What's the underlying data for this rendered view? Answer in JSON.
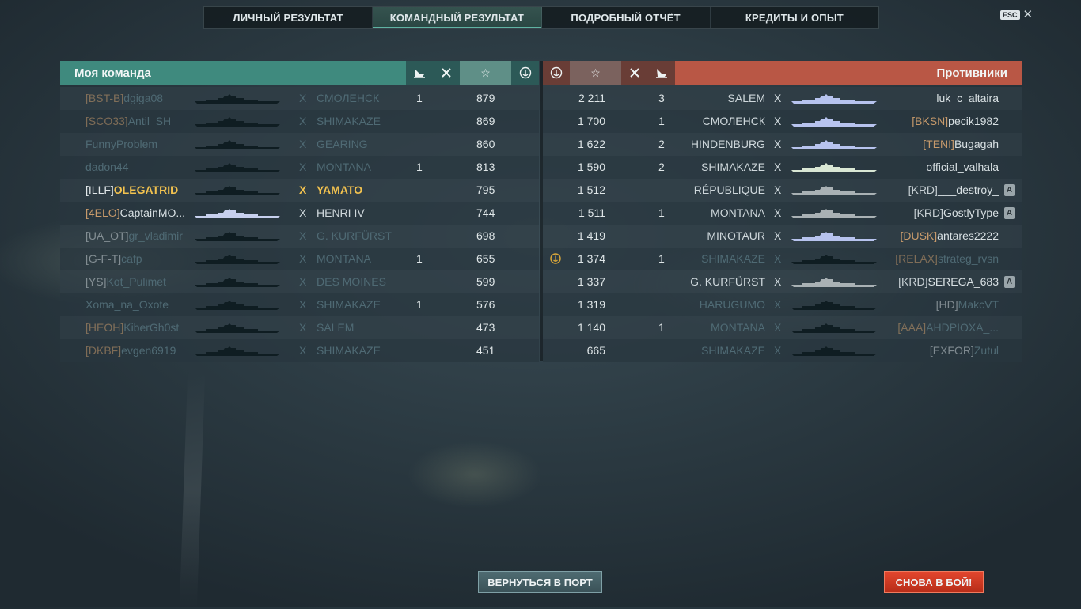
{
  "tabs": [
    {
      "label": "ЛИЧНЫЙ РЕЗУЛЬТАТ",
      "active": false
    },
    {
      "label": "КОМАНДНЫЙ РЕЗУЛЬТАТ",
      "active": true
    },
    {
      "label": "ПОДРОБНЫЙ ОТЧЁТ",
      "active": false
    },
    {
      "label": "КРЕДИТЫ И ОПЫТ",
      "active": false
    }
  ],
  "close": {
    "esc_label": "ESC",
    "icon": "close-icon"
  },
  "my_team": {
    "title": "Моя команда",
    "header_icons": [
      "ship-sunk-icon",
      "plane-kill-icon",
      "star-icon",
      "anchor-medal-icon"
    ],
    "players": [
      {
        "clan": "[BST-B]",
        "name": "dgiga08",
        "ship": "СМОЛЕНСК",
        "x": "X",
        "kills": "1",
        "score": "879",
        "dim": true,
        "highlight": false,
        "sil_color": "#0f1d22"
      },
      {
        "clan": "[SCO33]",
        "name": "Antil_SH",
        "ship": "SHIMAKAZE",
        "x": "X",
        "kills": "",
        "score": "869",
        "dim": true,
        "highlight": false,
        "sil_color": "#0f1d22"
      },
      {
        "clan": "",
        "name": "FunnyProblem",
        "ship": "GEARING",
        "x": "X",
        "kills": "",
        "score": "860",
        "dim": true,
        "highlight": false,
        "sil_color": "#0f1d22"
      },
      {
        "clan": "",
        "name": "dadon44",
        "ship": "MONTANA",
        "x": "X",
        "kills": "1",
        "score": "813",
        "dim": true,
        "highlight": false,
        "sil_color": "#0f1d22"
      },
      {
        "clan": "[ILLF]",
        "name": "OLEGATRID",
        "ship": "YAMATO",
        "x": "X",
        "kills": "",
        "score": "795",
        "dim": false,
        "highlight": true,
        "sil_color": "#0f1d22"
      },
      {
        "clan": "[4ELO]",
        "name": "CaptainMO...",
        "ship": "HENRI IV",
        "x": "X",
        "kills": "",
        "score": "744",
        "dim": false,
        "highlight": false,
        "sil_color": "#c7d0ee"
      },
      {
        "clan": "[UA_OT]",
        "name": "gr_vladimir",
        "ship": "G. KURFÜRST",
        "x": "X",
        "kills": "",
        "score": "698",
        "dim": true,
        "highlight": false,
        "clan_gray": true,
        "sil_color": "#0f1d22"
      },
      {
        "clan": "[G-F-T]",
        "name": "cafp",
        "ship": "MONTANA",
        "x": "X",
        "kills": "1",
        "score": "655",
        "dim": true,
        "highlight": false,
        "clan_gray": true,
        "sil_color": "#0f1d22"
      },
      {
        "clan": "[YS]",
        "name": "Kot_Pulimet",
        "ship": "DES MOINES",
        "x": "X",
        "kills": "",
        "score": "599",
        "dim": true,
        "highlight": false,
        "clan_gray": true,
        "sil_color": "#0f1d22"
      },
      {
        "clan": "",
        "name": "Xoma_na_Oxote",
        "ship": "SHIMAKAZE",
        "x": "X",
        "kills": "1",
        "score": "576",
        "dim": true,
        "highlight": false,
        "sil_color": "#0f1d22"
      },
      {
        "clan": "[HEOH]",
        "name": "KiberGh0st",
        "ship": "SALEM",
        "x": "X",
        "kills": "",
        "score": "473",
        "dim": true,
        "highlight": false,
        "sil_color": "#0f1d22"
      },
      {
        "clan": "[DKBF]",
        "name": "evgen6919",
        "ship": "SHIMAKAZE",
        "x": "X",
        "kills": "",
        "score": "451",
        "dim": true,
        "highlight": false,
        "sil_color": "#0f1d22"
      }
    ]
  },
  "enemy_team": {
    "title": "Противники",
    "header_icons": [
      "anchor-medal-icon",
      "star-icon",
      "plane-kill-icon",
      "ship-sunk-icon"
    ],
    "players": [
      {
        "score": "2 211",
        "kills": "3",
        "ship": "SALEM",
        "x": "X",
        "clan": "",
        "name": "luk_c_altaira",
        "dim": false,
        "badge": false,
        "division": "",
        "sil_color": "#b7c3ee"
      },
      {
        "score": "1 700",
        "kills": "1",
        "ship": "СМОЛЕНСК",
        "x": "X",
        "clan": "[BKSN]",
        "name": "pecik1982",
        "dim": false,
        "badge": false,
        "division": "",
        "sil_color": "#b7c3ee"
      },
      {
        "score": "1 622",
        "kills": "2",
        "ship": "HINDENBURG",
        "x": "X",
        "clan": "[TENI]",
        "name": "Bugagah",
        "dim": false,
        "badge": false,
        "division": "",
        "sil_color": "#b7c3ee"
      },
      {
        "score": "1 590",
        "kills": "2",
        "ship": "SHIMAKAZE",
        "x": "X",
        "clan": "",
        "name": "official_valhala",
        "dim": false,
        "badge": false,
        "division": "",
        "sil_color": "#d9e7d4"
      },
      {
        "score": "1 512",
        "kills": "",
        "ship": "RÉPUBLIQUE",
        "x": "X",
        "clan": "[KRD]",
        "name": "___destroy_",
        "dim": false,
        "badge": false,
        "division": "A",
        "clan_gray": true,
        "sil_color": "#a9b1b4"
      },
      {
        "score": "1 511",
        "kills": "1",
        "ship": "MONTANA",
        "x": "X",
        "clan": "[KRD]",
        "name": "GostlyType",
        "dim": false,
        "badge": false,
        "division": "A",
        "clan_gray": true,
        "sil_color": "#a9b1b4"
      },
      {
        "score": "1 419",
        "kills": "",
        "ship": "MINOTAUR",
        "x": "X",
        "clan": "[DUSK]",
        "name": "antares2222",
        "dim": false,
        "badge": false,
        "division": "",
        "sil_color": "#b7c3ee"
      },
      {
        "score": "1 374",
        "kills": "1",
        "ship": "SHIMAKAZE",
        "x": "X",
        "clan": "[RELAX]",
        "name": "strateg_rvsn",
        "dim": true,
        "badge": true,
        "division": "",
        "sil_color": "#0f1d22"
      },
      {
        "score": "1 337",
        "kills": "",
        "ship": "G. KURFÜRST",
        "x": "X",
        "clan": "[KRD]",
        "name": "SEREGA_683",
        "dim": false,
        "badge": false,
        "division": "A",
        "clan_gray": true,
        "sil_color": "#a9b1b4"
      },
      {
        "score": "1 319",
        "kills": "",
        "ship": "HARUGUMO",
        "x": "X",
        "clan": "[HD]",
        "name": "MakcVT",
        "dim": true,
        "badge": false,
        "division": "",
        "clan_gray": true,
        "sil_color": "#0f1d22"
      },
      {
        "score": "1 140",
        "kills": "1",
        "ship": "MONTANA",
        "x": "X",
        "clan": "[AAA]",
        "name": "AHDPIOXA_...",
        "dim": true,
        "badge": false,
        "division": "",
        "sil_color": "#0f1d22"
      },
      {
        "score": "665",
        "kills": "",
        "ship": "SHIMAKAZE",
        "x": "X",
        "clan": "[EXFOR]",
        "name": "Zutul",
        "dim": true,
        "badge": false,
        "division": "",
        "clan_gray": true,
        "sil_color": "#0f1d22"
      }
    ]
  },
  "buttons": {
    "return_port": "ВЕРНУТЬСЯ В ПОРТ",
    "battle_again": "СНОВА В БОЙ!"
  }
}
